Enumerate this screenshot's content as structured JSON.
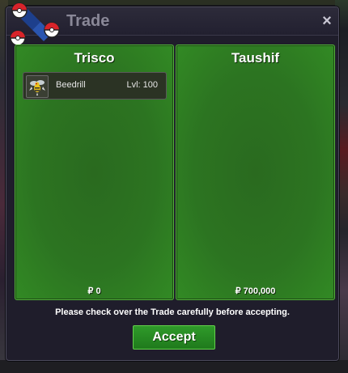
{
  "window": {
    "title": "Trade",
    "close_icon": "×"
  },
  "left_panel": {
    "player_name": "Trisco",
    "items": [
      {
        "name": "Beedrill",
        "level": "Lvl: 100",
        "icon": "beedrill-icon"
      }
    ],
    "money": "₽ 0"
  },
  "right_panel": {
    "player_name": "Taushif",
    "items": [],
    "money": "₽ 700,000"
  },
  "footer": {
    "notice": "Please check over the Trade carefully before accepting.",
    "accept_label": "Accept"
  },
  "colors": {
    "panel_green": "#2c7421",
    "panel_border": "#52b23a",
    "window_bg": "#1f1d2b",
    "accept_green": "#1f7a1c"
  }
}
